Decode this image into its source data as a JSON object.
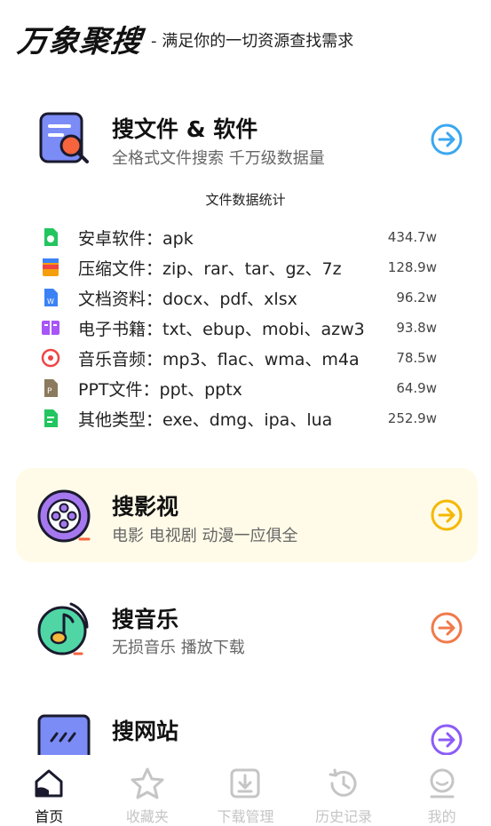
{
  "header": {
    "brand": "万象聚搜",
    "slogan": "- 满足你的一切资源查找需求"
  },
  "cards": {
    "files": {
      "title": "搜文件 & 软件",
      "subtitle": "全格式文件搜索 千万级数据量"
    },
    "video": {
      "title": "搜影视",
      "subtitle": "电影 电视剧 动漫一应俱全"
    },
    "music": {
      "title": "搜音乐",
      "subtitle": "无损音乐 播放下载"
    },
    "web": {
      "title": "搜网站"
    }
  },
  "stats": {
    "title": "文件数据统计",
    "rows": [
      {
        "label": "安卓软件：apk",
        "count": "434.7w",
        "icon": "android-icon",
        "color": "#22c55e"
      },
      {
        "label": "压缩文件：zip、rar、tar、gz、7z",
        "count": "128.9w",
        "icon": "archive-icon",
        "color": "#f59e0b"
      },
      {
        "label": "文档资料：docx、pdf、xlsx",
        "count": "96.2w",
        "icon": "document-icon",
        "color": "#3b82f6"
      },
      {
        "label": "电子书籍：txt、ebup、mobi、azw3",
        "count": "93.8w",
        "icon": "ebook-icon",
        "color": "#a855f7"
      },
      {
        "label": "音乐音频：mp3、flac、wma、m4a",
        "count": "78.5w",
        "icon": "music-disc-icon",
        "color": "#ef4444"
      },
      {
        "label": "PPT文件：ppt、pptx",
        "count": "64.9w",
        "icon": "ppt-icon",
        "color": "#8b7a5e"
      },
      {
        "label": "其他类型：exe、dmg、ipa、lua",
        "count": "252.9w",
        "icon": "other-file-icon",
        "color": "#22c55e"
      }
    ]
  },
  "tabs": [
    {
      "label": "首页",
      "icon": "home-icon",
      "active": true
    },
    {
      "label": "收藏夹",
      "icon": "star-icon"
    },
    {
      "label": "下载管理",
      "icon": "download-icon"
    },
    {
      "label": "历史记录",
      "icon": "history-icon"
    },
    {
      "label": "我的",
      "icon": "profile-icon"
    }
  ],
  "colors": {
    "files_arrow": "#3ba7f0",
    "video_arrow": "#f5b800",
    "music_arrow": "#f07a4a",
    "web_arrow": "#8b5cf6",
    "video_card_bg": "#fffbe8"
  }
}
